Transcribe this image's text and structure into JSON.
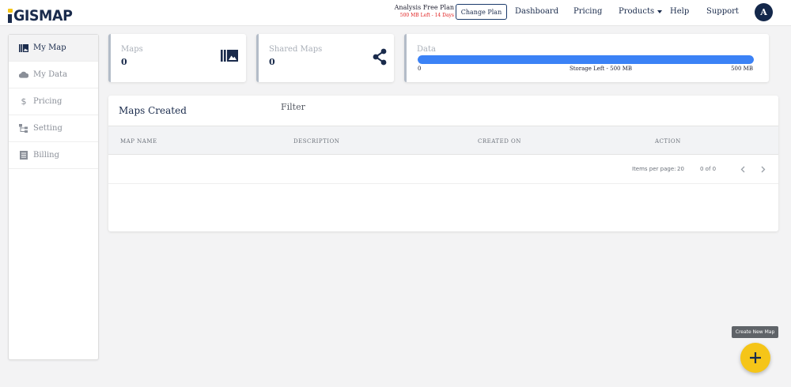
{
  "header": {
    "logo_text": "GISMAP",
    "plan_title": "Analysis Free Plan",
    "plan_subtitle": "500 MB Left - 14 Days",
    "change_plan_label": "Change Plan",
    "nav": {
      "dashboard": "Dashboard",
      "pricing": "Pricing",
      "products": "Products",
      "help": "Help",
      "support": "Support"
    },
    "avatar_initial": "A"
  },
  "sidebar": {
    "items": [
      {
        "label": "My Map",
        "icon": "map-gallery-icon",
        "active": true
      },
      {
        "label": "My Data",
        "icon": "cloud-icon",
        "active": false
      },
      {
        "label": "Pricing",
        "icon": "dollar-icon",
        "active": false
      },
      {
        "label": "Setting",
        "icon": "hierarchy-icon",
        "active": false
      },
      {
        "label": "Billing",
        "icon": "list-icon",
        "active": false
      }
    ]
  },
  "stats": {
    "maps": {
      "title": "Maps",
      "value": "0",
      "icon": "map-gallery-icon"
    },
    "shared_maps": {
      "title": "Shared Maps",
      "value": "0",
      "icon": "share-icon"
    },
    "data": {
      "title": "Data",
      "min_label": "0",
      "center_label": "Storage Left - 500 MB",
      "max_label": "500 MB",
      "fill_percent": 100
    }
  },
  "maps_table": {
    "title": "Maps Created",
    "filter_label": "Filter",
    "columns": [
      "MAP NAME",
      "DESCRIPTION",
      "CREATED ON",
      "ACTION"
    ],
    "rows": [],
    "items_per_page_label": "Items per page:",
    "items_per_page": "20",
    "range_label": "0 of 0"
  },
  "fab": {
    "tooltip": "Create New Map",
    "icon": "plus-icon"
  },
  "colors": {
    "brand_navy": "#1a2b4c",
    "brand_yellow": "#f5c518",
    "progress_blue": "#3b82f6",
    "warning_red": "#e02020"
  }
}
